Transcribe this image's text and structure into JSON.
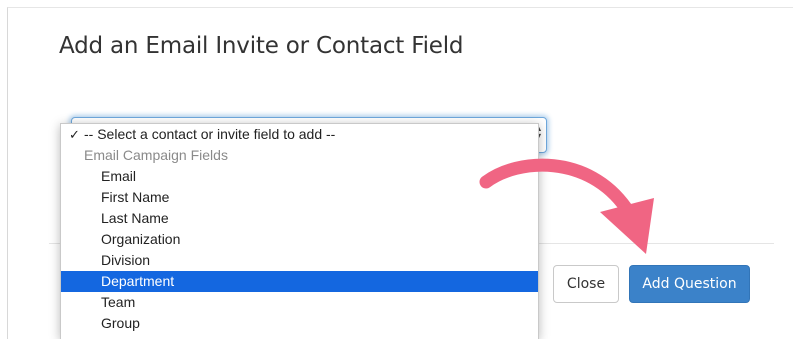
{
  "dialog": {
    "title": "Add an Email Invite or Contact Field"
  },
  "select": {
    "selected_value": "-- Select a contact or invite field to add --"
  },
  "dropdown": {
    "check_glyph": "✓",
    "placeholder_option": "-- Select a contact or invite field to add --",
    "group_label": "Email Campaign Fields",
    "options": [
      "Email",
      "First Name",
      "Last Name",
      "Organization",
      "Division",
      "Department",
      "Team",
      "Group"
    ],
    "highlighted_option": "Department"
  },
  "buttons": {
    "close_label": "Close",
    "add_label": "Add Question"
  },
  "colors": {
    "highlight": "#1467e0",
    "primary_button": "#3b82c9",
    "annotation_arrow": "#f06583"
  },
  "annotation": {
    "icon": "curved-arrow-icon"
  }
}
